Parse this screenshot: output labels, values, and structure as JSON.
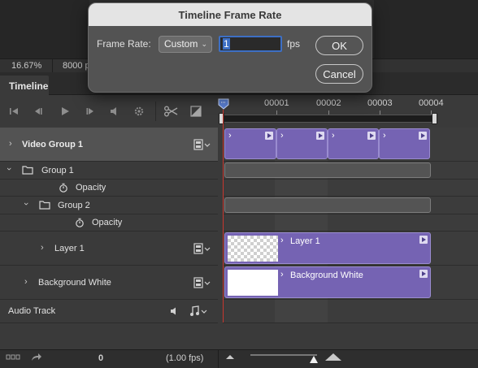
{
  "status": {
    "zoom": "16.67%",
    "doc_size": "8000 p"
  },
  "panel": {
    "tab": "Timeline"
  },
  "ruler": {
    "labels": [
      "00001",
      "00002",
      "00003",
      "00004"
    ]
  },
  "layers": {
    "video_group": "Video Group 1",
    "group1": "Group 1",
    "opacity1": "Opacity",
    "group2": "Group 2",
    "opacity2": "Opacity",
    "layer1": "Layer 1",
    "bg_white": "Background White",
    "audio": "Audio Track"
  },
  "clips": {
    "layer1": "Layer 1",
    "bg_white": "Background White"
  },
  "footer": {
    "current_frame": "0",
    "fps": "(1.00 fps)"
  },
  "dialog": {
    "title": "Timeline Frame Rate",
    "frame_rate_label": "Frame Rate:",
    "frame_rate_value": "Custom",
    "frame_rate_input": "1",
    "fps_unit": "fps",
    "ok": "OK",
    "cancel": "Cancel"
  },
  "colors": {
    "clip": "#7563b3",
    "playhead": "#c8372e",
    "accent": "#3d6fc4"
  }
}
